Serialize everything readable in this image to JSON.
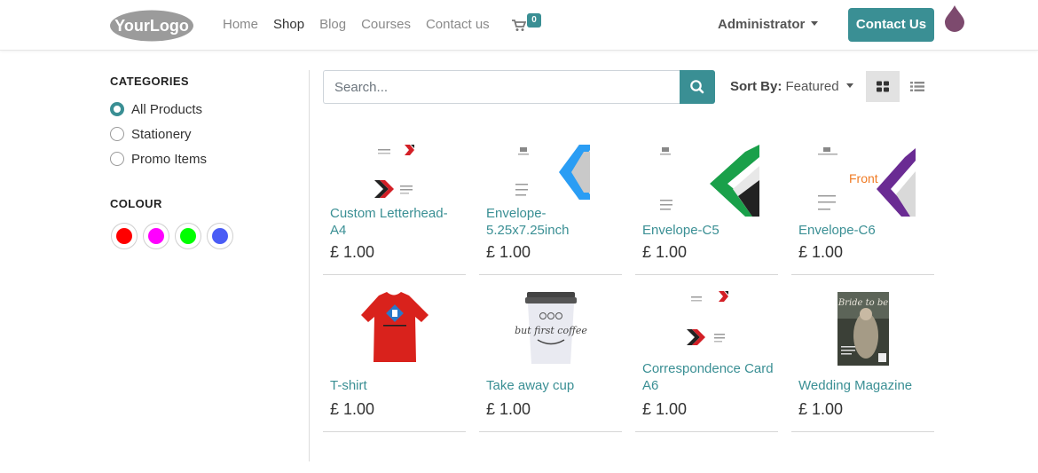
{
  "brand": {
    "logo_text": "YourLogo"
  },
  "nav": {
    "items": [
      "Home",
      "Shop",
      "Blog",
      "Courses",
      "Contact us"
    ],
    "active": "Shop"
  },
  "cart": {
    "count": "0",
    "icon": "cart-icon"
  },
  "user": {
    "name": "Administrator"
  },
  "header_cta": {
    "label": "Contact Us"
  },
  "colors": {
    "accent": "#3a8f94",
    "link": "#3a8f94",
    "nav_text": "#8a8a8a"
  },
  "sidebar": {
    "categories_title": "CATEGORIES",
    "categories": [
      {
        "label": "All Products",
        "selected": true
      },
      {
        "label": "Stationery",
        "selected": false
      },
      {
        "label": "Promo Items",
        "selected": false
      }
    ],
    "colour_title": "COLOUR",
    "colours": [
      {
        "name": "red",
        "hex": "#ff0000"
      },
      {
        "name": "magenta",
        "hex": "#ff00ff"
      },
      {
        "name": "green",
        "hex": "#00ff00"
      },
      {
        "name": "blue",
        "hex": "#4a5cf5"
      }
    ]
  },
  "search": {
    "placeholder": "Search...",
    "value": ""
  },
  "sort": {
    "label": "Sort By:",
    "value": "Featured"
  },
  "view": {
    "active": "grid"
  },
  "products": [
    {
      "name": "Custom Letterhead-A4",
      "price": "£ 1.00",
      "image": "letterhead-red"
    },
    {
      "name": "Envelope-5.25x7.25inch",
      "price": "£ 1.00",
      "image": "envelope-blue"
    },
    {
      "name": "Envelope-C5",
      "price": "£ 1.00",
      "image": "envelope-green"
    },
    {
      "name": "Envelope-C6",
      "price": "£ 1.00",
      "image": "envelope-purple",
      "image_text": "Front"
    },
    {
      "name": "T-shirt",
      "price": "£ 1.00",
      "image": "tshirt-red"
    },
    {
      "name": "Take away cup",
      "price": "£ 1.00",
      "image": "takeaway-cup",
      "image_text": "but first coffee"
    },
    {
      "name": "Correspondence Card A6",
      "price": "£ 1.00",
      "image": "card-red"
    },
    {
      "name": "Wedding Magazine",
      "price": "£ 1.00",
      "image": "magazine-cover",
      "image_text": "Bride to be"
    }
  ]
}
